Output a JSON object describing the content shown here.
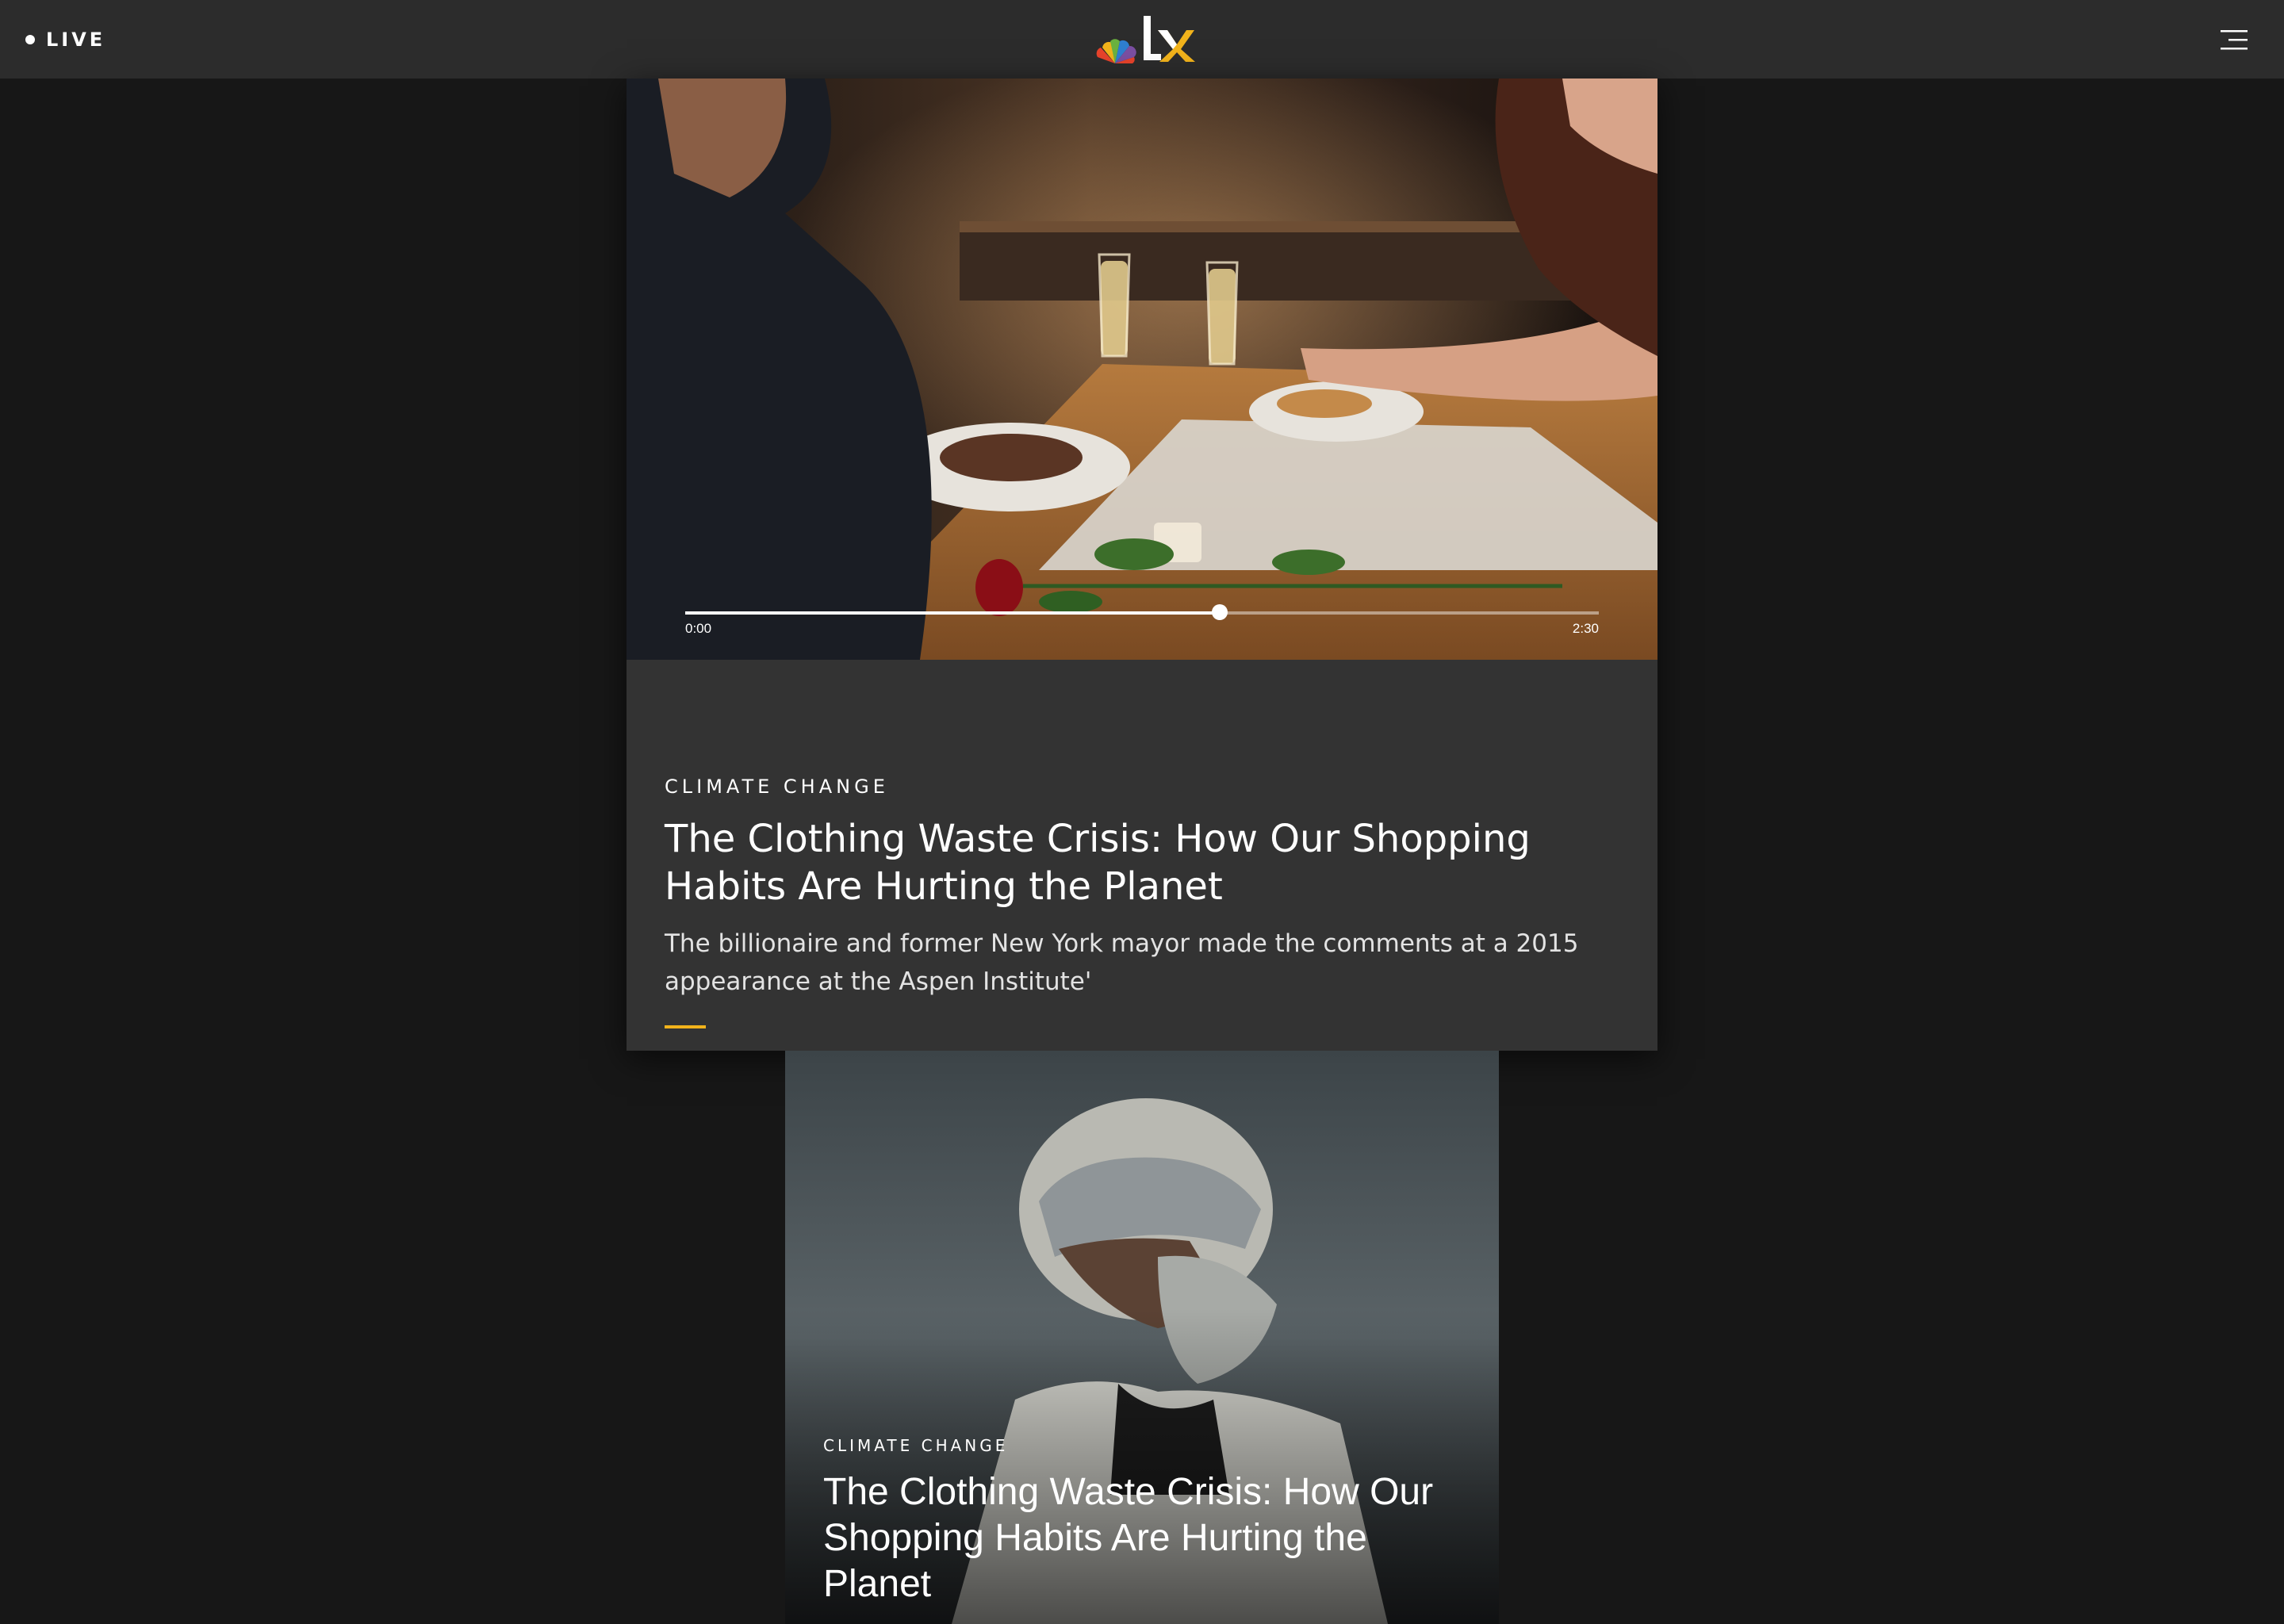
{
  "header": {
    "live_label": "LIVE",
    "logo_text": "LX",
    "live_dot_icon": "live-dot-icon",
    "menu_icon": "hamburger-menu-icon"
  },
  "featured": {
    "video": {
      "current_time": "0:00",
      "duration": "2:30",
      "progress_fraction": 0.585
    },
    "kicker": "CLIMATE CHANGE",
    "headline": "The Clothing Waste Crisis: How Our Shopping Habits Are Hurting the Planet",
    "dek": "The billionaire and former New York mayor made the comments at a 2015 appearance at the Aspen Institute'",
    "share_icon": "share-icon"
  },
  "second_story": {
    "kicker": "CLIMATE CHANGE",
    "headline": "The Clothing Waste Crisis: How Our Shopping Habits Are Hurting the Planet"
  },
  "colors": {
    "page_background": "#171717",
    "header_background": "#2c2c2c",
    "card_background": "#333333",
    "accent": "#f2b31b",
    "text": "#ffffff"
  }
}
